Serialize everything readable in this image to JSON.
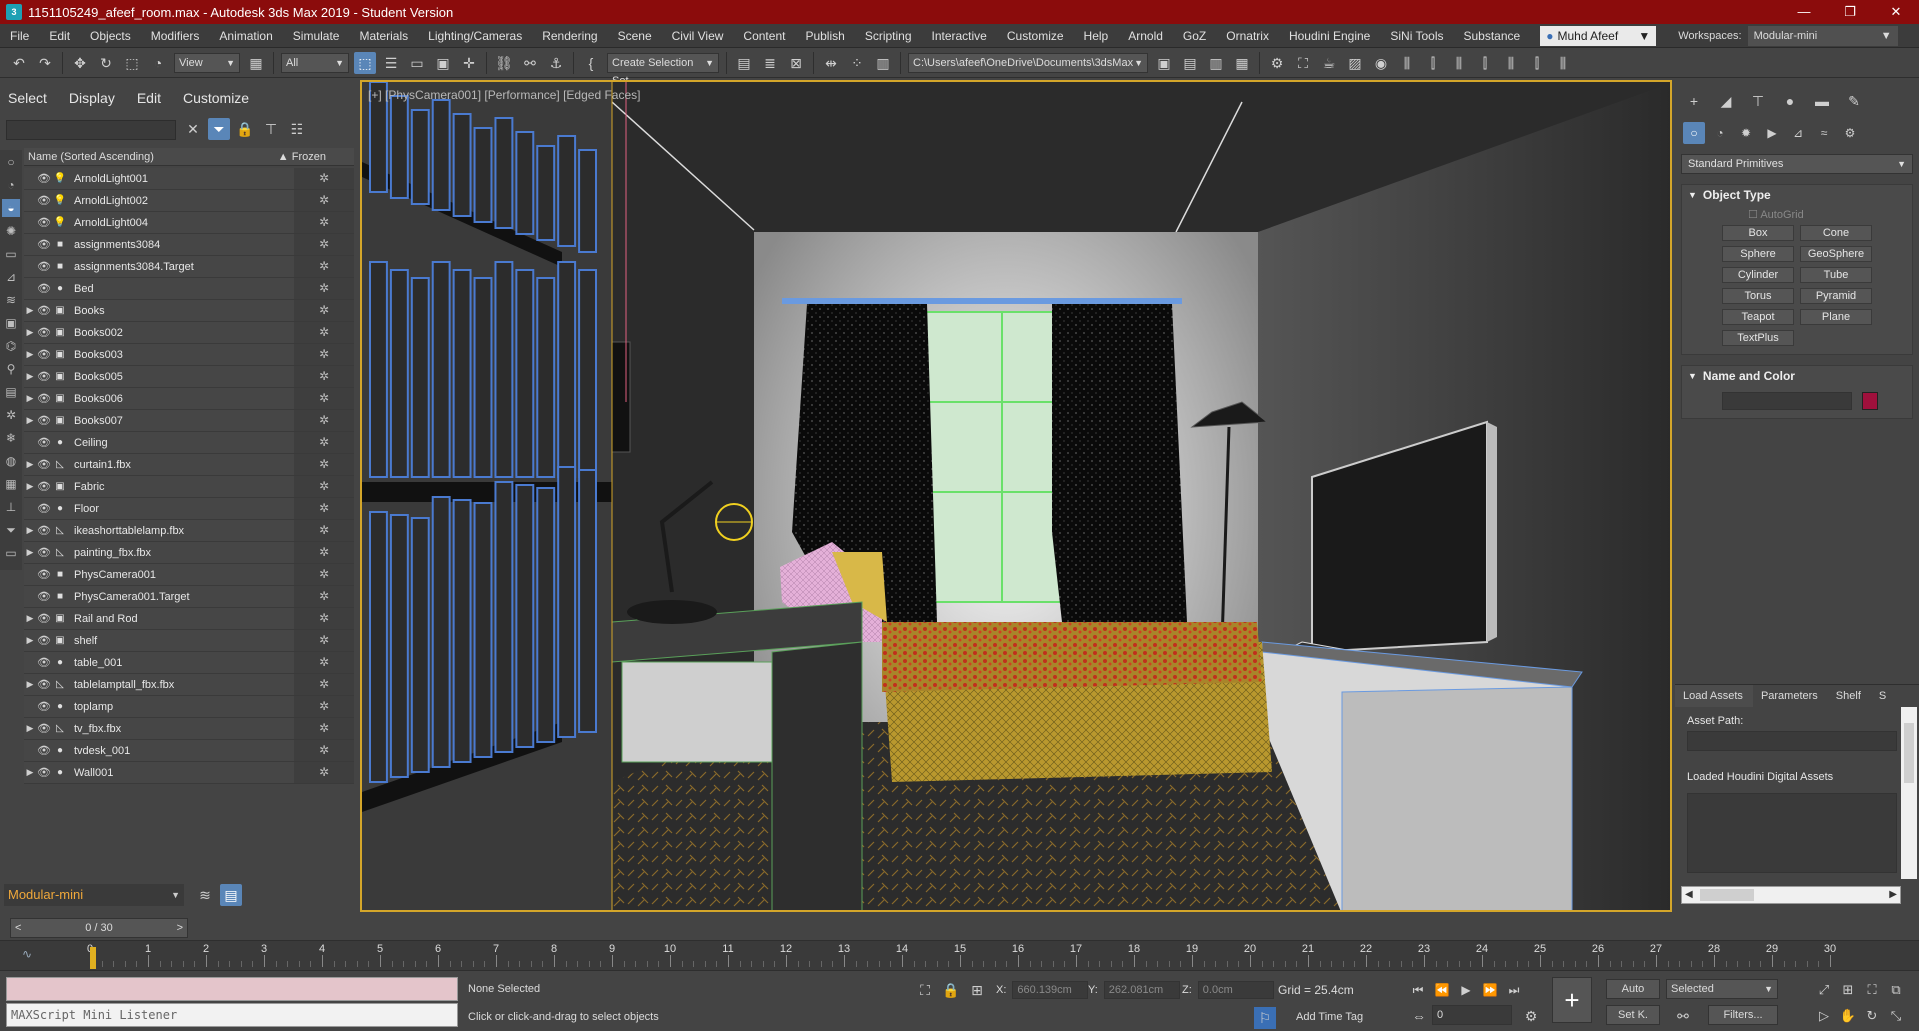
{
  "window": {
    "title": "1151105249_afeef_room.max - Autodesk 3ds Max 2019 - Student Version",
    "minimize": "—",
    "restore": "❐",
    "close": "✕"
  },
  "menu": {
    "items": [
      "File",
      "Edit",
      "Objects",
      "Modifiers",
      "Animation",
      "Simulate",
      "Materials",
      "Lighting/Cameras",
      "Rendering",
      "Scene",
      "Civil View",
      "Content",
      "Publish",
      "Scripting",
      "Interactive",
      "Customize",
      "Help",
      "Arnold",
      "GoZ",
      "Ornatrix",
      "Houdini Engine",
      "SiNi Tools",
      "Substance"
    ],
    "user": "Muhd Afeef",
    "workspaces_label": "Workspaces:",
    "workspace": "Modular-mini"
  },
  "toolbar": {
    "view_dropdown": "View",
    "filter_dropdown": "All",
    "selection_set": "Create Selection Set",
    "path": "C:\\Users\\afeef\\OneDrive\\Documents\\3dsMax"
  },
  "explorer": {
    "tabs": [
      "Select",
      "Display",
      "Edit",
      "Customize"
    ],
    "column_name": "Name (Sorted Ascending)",
    "column_frozen": "Frozen",
    "rows": [
      {
        "name": "ArnoldLight001",
        "type": "light",
        "expand": false
      },
      {
        "name": "ArnoldLight002",
        "type": "light",
        "expand": false
      },
      {
        "name": "ArnoldLight004",
        "type": "light",
        "expand": false
      },
      {
        "name": "assignments3084",
        "type": "camera",
        "expand": false
      },
      {
        "name": "assignments3084.Target",
        "type": "camera",
        "expand": false
      },
      {
        "name": "Bed",
        "type": "geometry",
        "expand": false
      },
      {
        "name": "Books",
        "type": "group",
        "expand": true
      },
      {
        "name": "Books002",
        "type": "group",
        "expand": true
      },
      {
        "name": "Books003",
        "type": "group",
        "expand": true
      },
      {
        "name": "Books005",
        "type": "group",
        "expand": true
      },
      {
        "name": "Books006",
        "type": "group",
        "expand": true
      },
      {
        "name": "Books007",
        "type": "group",
        "expand": true
      },
      {
        "name": "Ceiling",
        "type": "geometry",
        "expand": false
      },
      {
        "name": "curtain1.fbx",
        "type": "helper",
        "expand": true
      },
      {
        "name": "Fabric",
        "type": "group",
        "expand": true
      },
      {
        "name": "Floor",
        "type": "geometry",
        "expand": false
      },
      {
        "name": "ikeashorttablelamp.fbx",
        "type": "helper",
        "expand": true
      },
      {
        "name": "painting_fbx.fbx",
        "type": "helper",
        "expand": true
      },
      {
        "name": "PhysCamera001",
        "type": "camera",
        "expand": false
      },
      {
        "name": "PhysCamera001.Target",
        "type": "camera",
        "expand": false
      },
      {
        "name": "Rail and Rod",
        "type": "group",
        "expand": true
      },
      {
        "name": "shelf",
        "type": "group",
        "expand": true
      },
      {
        "name": "table_001",
        "type": "geometry",
        "expand": false
      },
      {
        "name": "tablelamptall_fbx.fbx",
        "type": "helper",
        "expand": true
      },
      {
        "name": "toplamp",
        "type": "geometry",
        "expand": false
      },
      {
        "name": "tv_fbx.fbx",
        "type": "helper",
        "expand": true
      },
      {
        "name": "tvdesk_001",
        "type": "geometry",
        "expand": false
      },
      {
        "name": "Wall001",
        "type": "geometry",
        "expand": true
      }
    ],
    "workspace_box": "Modular-mini",
    "frame_display": "0 / 30"
  },
  "viewport": {
    "label": "[+] [PhysCamera001] [Performance] [Edged Faces]"
  },
  "command_panel": {
    "primitives_dropdown": "Standard Primitives",
    "object_type_title": "Object Type",
    "autogrid": "AutoGrid",
    "buttons": [
      "Box",
      "Cone",
      "Sphere",
      "GeoSphere",
      "Cylinder",
      "Tube",
      "Torus",
      "Pyramid",
      "Teapot",
      "Plane",
      "TextPlus"
    ],
    "name_color_title": "Name and Color",
    "color_swatch": "#a0103c"
  },
  "assets": {
    "tabs": [
      "Load Assets",
      "Parameters",
      "Shelf",
      "S"
    ],
    "asset_path_label": "Asset Path:",
    "loaded_label": "Loaded Houdini Digital Assets"
  },
  "timeline": {
    "labels": [
      "0",
      "1",
      "2",
      "3",
      "4",
      "5",
      "6",
      "7",
      "8",
      "9",
      "10",
      "11",
      "12",
      "13",
      "14",
      "15",
      "16",
      "17",
      "18",
      "19",
      "20",
      "21",
      "22",
      "23",
      "24",
      "25",
      "26",
      "27",
      "28",
      "29",
      "30"
    ]
  },
  "status": {
    "maxscript": "MAXScript Mini Listener",
    "selection": "None Selected",
    "hint": "Click or click-and-drag to select objects",
    "x_label": "X:",
    "x_value": "660.139cm",
    "y_label": "Y:",
    "y_value": "262.081cm",
    "z_label": "Z:",
    "z_value": "0.0cm",
    "grid": "Grid = 25.4cm",
    "add_time_tag": "Add Time Tag",
    "auto": "Auto",
    "set_key": "Set K.",
    "selected": "Selected",
    "filters": "Filters...",
    "frame_field": "0"
  }
}
